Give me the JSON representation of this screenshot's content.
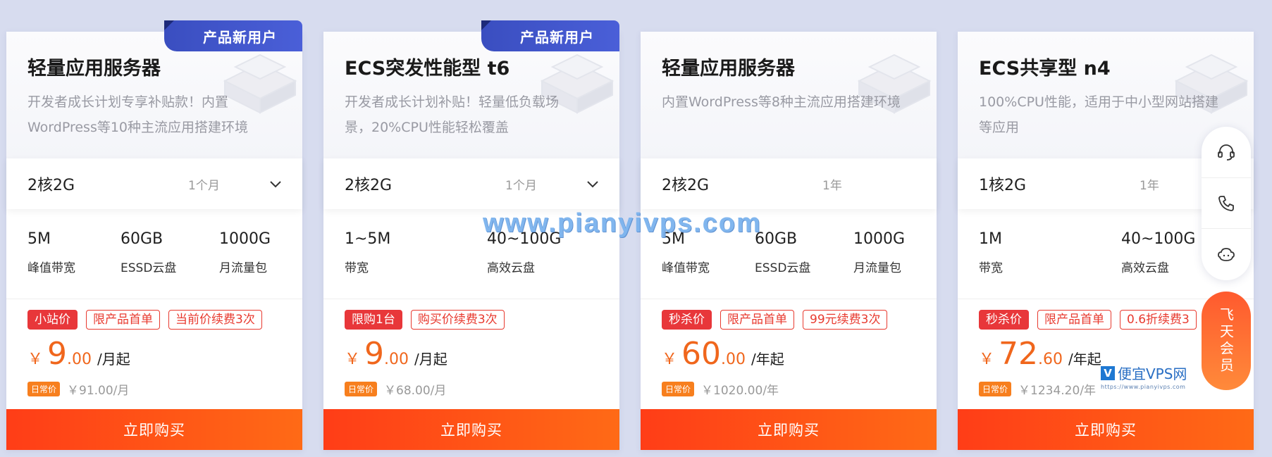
{
  "cards": [
    {
      "new_badge": "产品新用户",
      "title": "轻量应用服务器",
      "desc": "开发者成长计划专享补贴款！内置WordPress等10种主流应用搭建环境",
      "spec": "2核2G",
      "period": "1个月",
      "has_dropdown": true,
      "features": [
        {
          "value": "5M",
          "label": "峰值带宽"
        },
        {
          "value": "60GB",
          "label": "ESSD云盘"
        },
        {
          "value": "1000G",
          "label": "月流量包"
        }
      ],
      "tags": [
        "小站价",
        "限产品首单",
        "当前价续费3次"
      ],
      "price_int": "9",
      "price_dec": ".00",
      "price_unit": "/月起",
      "daily_label": "日常价",
      "daily_price": "￥91.00/月",
      "buy": "立即购买"
    },
    {
      "new_badge": "产品新用户",
      "title": "ECS突发性能型 t6",
      "desc": "开发者成长计划补贴！轻量低负载场景，20%CPU性能轻松覆盖",
      "spec": "2核2G",
      "period": "1个月",
      "has_dropdown": true,
      "features": [
        {
          "value": "1~5M",
          "label": "带宽"
        },
        {
          "value": "40~100G",
          "label": "高效云盘"
        }
      ],
      "tags": [
        "限购1台",
        "购买价续费3次"
      ],
      "price_int": "9",
      "price_dec": ".00",
      "price_unit": "/月起",
      "daily_label": "日常价",
      "daily_price": "￥68.00/月",
      "buy": "立即购买"
    },
    {
      "new_badge": "",
      "title": "轻量应用服务器",
      "desc": "内置WordPress等8种主流应用搭建环境",
      "spec": "2核2G",
      "period": "1年",
      "has_dropdown": false,
      "features": [
        {
          "value": "5M",
          "label": "峰值带宽"
        },
        {
          "value": "60GB",
          "label": "ESSD云盘"
        },
        {
          "value": "1000G",
          "label": "月流量包"
        }
      ],
      "tags": [
        "秒杀价",
        "限产品首单",
        "99元续费3次"
      ],
      "price_int": "60",
      "price_dec": ".00",
      "price_unit": "/年起",
      "daily_label": "日常价",
      "daily_price": "￥1020.00/年",
      "buy": "立即购买"
    },
    {
      "new_badge": "",
      "title": "ECS共享型 n4",
      "desc": "100%CPU性能，适用于中小型网站搭建等应用",
      "spec": "1核2G",
      "period": "1年",
      "has_dropdown": false,
      "features": [
        {
          "value": "1M",
          "label": "带宽"
        },
        {
          "value": "40~100G",
          "label": "高效云盘"
        }
      ],
      "tags": [
        "秒杀价",
        "限产品首单",
        "0.6折续费3"
      ],
      "price_int": "72",
      "price_dec": ".60",
      "price_unit": "/年起",
      "daily_label": "日常价",
      "daily_price": "￥1234.20/年",
      "buy": "立即购买"
    }
  ],
  "currency_symbol": "￥",
  "watermark_text": "www.pianyivps.com",
  "side_tools": [
    "headset-icon",
    "phone-icon",
    "chat-bot-icon"
  ],
  "vip_label": "飞天会员",
  "logo_watermark": {
    "mark": "V",
    "name": "便宜VPS网",
    "url": "https://www.pianyivps.com"
  },
  "colors": {
    "accent_orange": "#f0661c",
    "tag_red": "#e83a2f",
    "badge_blue": "#3a4ec0",
    "buy_gradient_start": "#ff3d17",
    "buy_gradient_end": "#ff6a16"
  }
}
